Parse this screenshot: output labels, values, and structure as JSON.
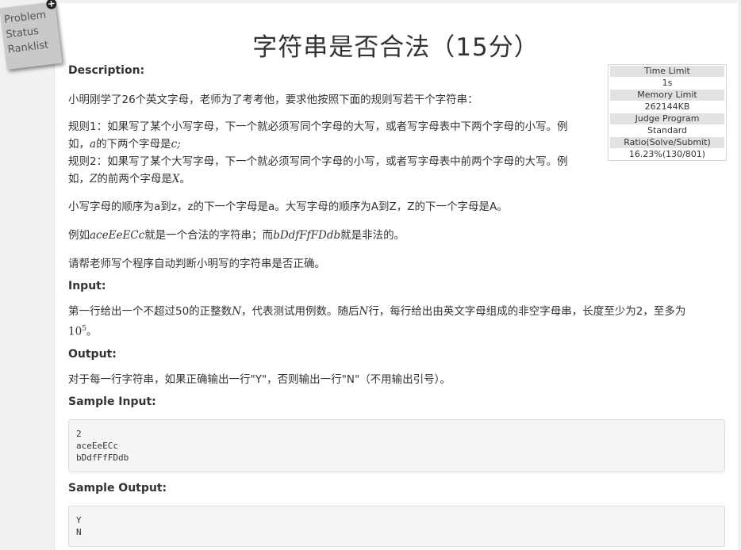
{
  "side_menu": {
    "items": [
      "Problem",
      "Status",
      "Ranklist"
    ],
    "expand_icon": "plus-circle-icon"
  },
  "title": "字符串是否合法（15分）",
  "limits": {
    "time_limit_label": "Time Limit",
    "time_limit": "1s",
    "memory_limit_label": "Memory Limit",
    "memory_limit": "262144KB",
    "judge_label": "Judge Program",
    "judge": "Standard",
    "ratio_label": "Ratio(Solve/Submit)",
    "ratio": "16.23%(130/801)"
  },
  "description": {
    "heading": "Description:",
    "p1": "小明刚学了26个英文字母，老师为了考考他，要求他按照下面的规则写若干个字符串：",
    "rule1_a": "规则1：如果写了某个小写字母，下一个就必须写同个字母的大写，或者写字母表中下两个字母的小写。例",
    "rule1_b_pre": "如，",
    "rule1_b_var1": "a",
    "rule1_b_mid": "的下两个字母是",
    "rule1_b_var2": "c",
    "rule1_b_end": ";",
    "rule2_a": "规则2：如果写了某个大写字母，下一个就必须写同个字母的小写，或者写字母表中前两个字母的大写。例",
    "rule2_b_pre": "如，",
    "rule2_b_var1": "Z",
    "rule2_b_mid": "的前两个字母是",
    "rule2_b_var2": "X",
    "rule2_b_end": "。",
    "p_order": "小写字母的顺序为a到z，z的下一个字母是a。大写字母的顺序为A到Z，Z的下一个字母是A。",
    "p_example_pre": "例如",
    "p_example_var1": "aceEeECc",
    "p_example_mid": "就是一个合法的字符串；而",
    "p_example_var2": "bDdfFfFDdb",
    "p_example_end": "就是非法的。",
    "p_ask": "请帮老师写个程序自动判断小明写的字符串是否正确。"
  },
  "input": {
    "heading": "Input:",
    "text_a": "第一行给出一个不超过50的正整数",
    "var_n1": "N",
    "text_b": "，代表测试用例数。随后",
    "var_n2": "N",
    "text_c": "行，每行给出由英文字母组成的非空字母串，长度至少为2，至多为",
    "pow_base": "10",
    "pow_exp": "5",
    "text_d": "。"
  },
  "output": {
    "heading": "Output:",
    "text": "对于每一行字符串，如果正确输出一行\"Y\"，否则输出一行\"N\"（不用输出引号）。"
  },
  "sample_input": {
    "heading": "Sample Input:",
    "lines": [
      "2",
      "aceEeECc",
      "bDdfFfFDdb"
    ]
  },
  "sample_output": {
    "heading": "Sample Output:",
    "lines": [
      "Y",
      "N"
    ]
  }
}
